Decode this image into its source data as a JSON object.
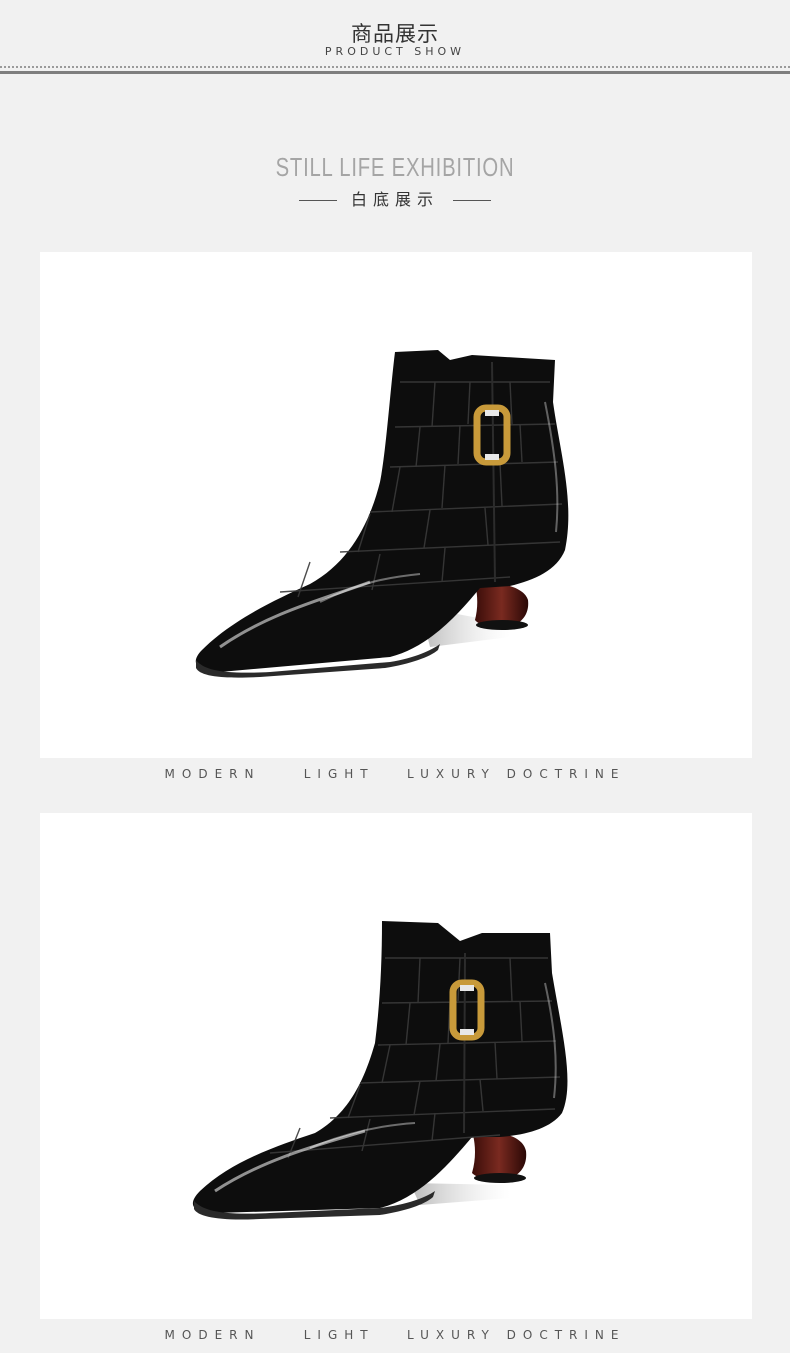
{
  "header": {
    "title": "商品展示",
    "subtitle": "PRODUCT SHOW"
  },
  "section": {
    "title": "STILL LIFE  EXHIBITION",
    "subtitle": "白底展示"
  },
  "panels": [
    {
      "caption": "MODERN    LIGHT   LUXURY DOCTRINE",
      "image": "black-patent-ankle-boot-side-view"
    },
    {
      "caption": "MODERN    LIGHT   LUXURY DOCTRINE",
      "image": "black-patent-ankle-boot-angle-view"
    }
  ],
  "colors": {
    "background": "#f1f1f1",
    "panel": "#ffffff",
    "boot": "#0d0d0d",
    "heel": "#6b1f17",
    "buckle": "#c89a3a"
  }
}
